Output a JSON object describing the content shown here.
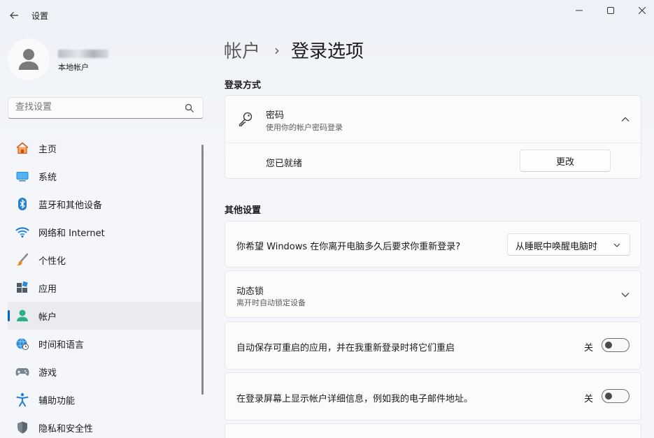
{
  "window": {
    "title": "设置"
  },
  "profile": {
    "name_redacted": true,
    "account_type": "本地帐户"
  },
  "search": {
    "placeholder": "查找设置"
  },
  "sidebar": {
    "items": [
      {
        "label": "主页",
        "icon": "home-icon"
      },
      {
        "label": "系统",
        "icon": "system-icon"
      },
      {
        "label": "蓝牙和其他设备",
        "icon": "bluetooth-icon"
      },
      {
        "label": "网络和 Internet",
        "icon": "wifi-icon"
      },
      {
        "label": "个性化",
        "icon": "brush-icon"
      },
      {
        "label": "应用",
        "icon": "apps-icon"
      },
      {
        "label": "帐户",
        "icon": "account-icon",
        "active": true
      },
      {
        "label": "时间和语言",
        "icon": "globe-clock-icon"
      },
      {
        "label": "游戏",
        "icon": "gamepad-icon"
      },
      {
        "label": "辅助功能",
        "icon": "accessibility-icon"
      },
      {
        "label": "隐私和安全性",
        "icon": "shield-icon"
      }
    ]
  },
  "breadcrumb": {
    "parent": "帐户",
    "separator": "›",
    "current": "登录选项"
  },
  "sign_in": {
    "heading": "登录方式",
    "password": {
      "title": "密码",
      "subtitle": "使用你的帐户密码登录",
      "status": "您已就绪",
      "change_label": "更改"
    }
  },
  "other": {
    "heading": "其他设置",
    "require_signin": {
      "label": "你希望 Windows 在你离开电脑多久后要求你重新登录?",
      "selected": "从睡眠中唤醒电脑时"
    },
    "dynamic_lock": {
      "title": "动态锁",
      "subtitle": "离开时自动锁定设备"
    },
    "restart_apps": {
      "label": "自动保存可重启的应用，并在我重新登录时将它们重启",
      "state": "关"
    },
    "show_details": {
      "label": "在登录屏幕上显示帐户详细信息，例如我的电子邮件地址。",
      "state": "关"
    }
  },
  "colors": {
    "accent": "#0067c0",
    "window_bg": "#f3f5f9",
    "card_bg": "#fbfbfc"
  }
}
